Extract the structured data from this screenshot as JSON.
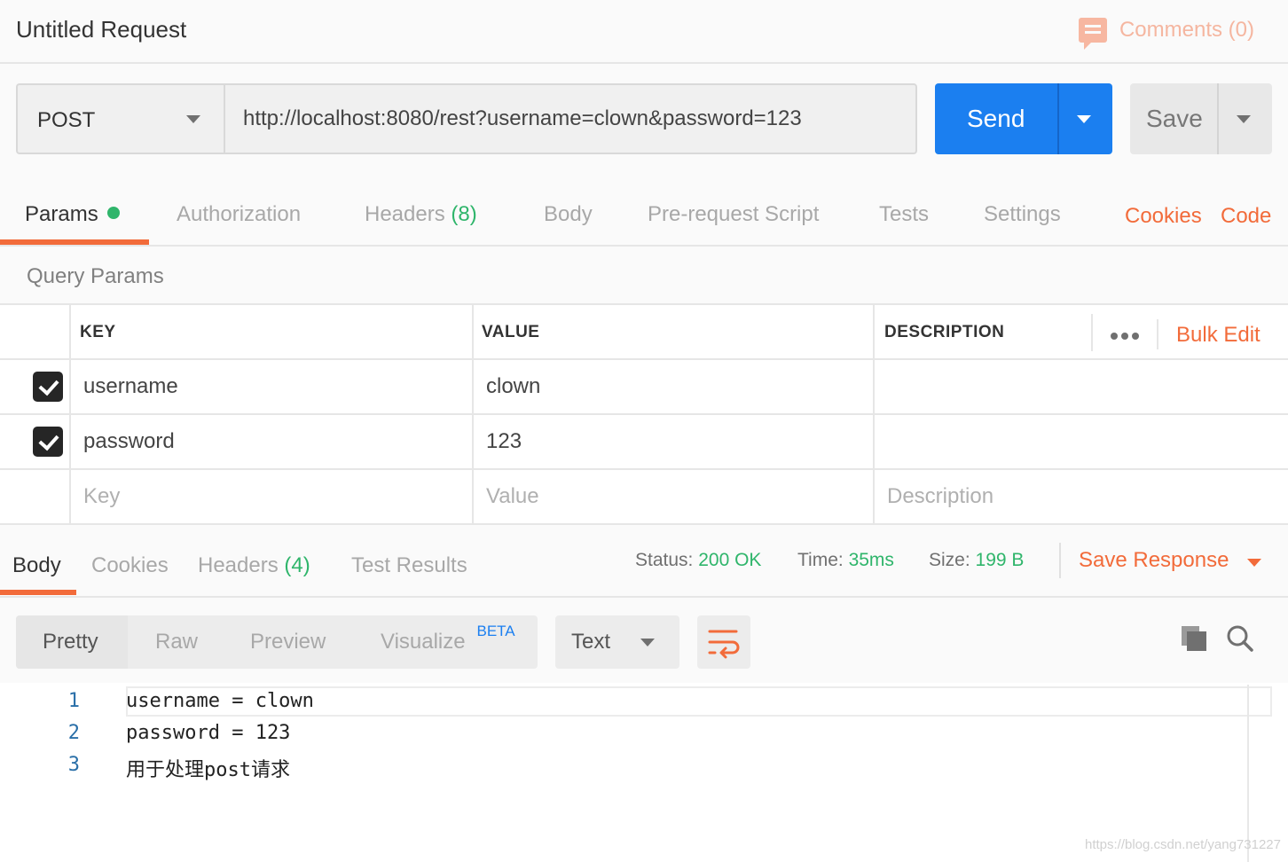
{
  "title": "Untitled Request",
  "comments_label": "Comments (0)",
  "request": {
    "method": "POST",
    "url": "http://localhost:8080/rest?username=clown&password=123",
    "send_label": "Send",
    "save_label": "Save"
  },
  "tabs": {
    "params": "Params",
    "authorization": "Authorization",
    "headers": "Headers",
    "headers_count": "(8)",
    "body": "Body",
    "prerequest": "Pre-request Script",
    "tests": "Tests",
    "settings": "Settings",
    "cookies": "Cookies",
    "code": "Code"
  },
  "query_params": {
    "title": "Query Params",
    "col_key": "KEY",
    "col_value": "VALUE",
    "col_description": "DESCRIPTION",
    "bulk_edit": "Bulk Edit",
    "rows": [
      {
        "checked": true,
        "key": "username",
        "value": "clown",
        "description": ""
      },
      {
        "checked": true,
        "key": "password",
        "value": "123",
        "description": ""
      }
    ],
    "placeholder_key": "Key",
    "placeholder_value": "Value",
    "placeholder_description": "Description"
  },
  "response": {
    "tabs": {
      "body": "Body",
      "cookies": "Cookies",
      "headers": "Headers",
      "headers_count": "(4)",
      "test_results": "Test Results"
    },
    "status_label": "Status:",
    "status_value": "200 OK",
    "time_label": "Time:",
    "time_value": "35ms",
    "size_label": "Size:",
    "size_value": "199 B",
    "save_response": "Save Response",
    "formats": {
      "pretty": "Pretty",
      "raw": "Raw",
      "preview": "Preview",
      "visualize": "Visualize",
      "beta": "BETA"
    },
    "text_select": "Text",
    "lines": [
      {
        "num": "1",
        "text": "username = clown"
      },
      {
        "num": "2",
        "text": "password = 123"
      },
      {
        "num": "3",
        "text": "用于处理post请求"
      }
    ]
  },
  "watermark": "https://blog.csdn.net/yang731227",
  "colors": {
    "accent": "#f26b3a",
    "send_blue": "#1b7ff0",
    "success_green": "#2fb56b"
  }
}
